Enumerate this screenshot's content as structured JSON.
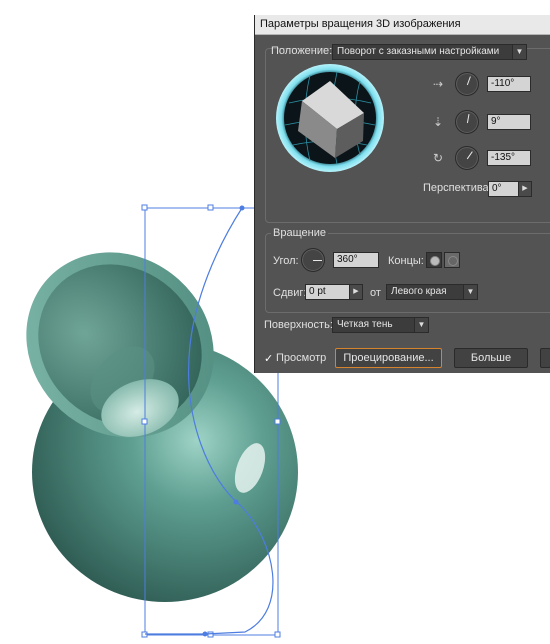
{
  "dialog": {
    "title": "Параметры вращения 3D изображения",
    "position": {
      "label": "Положение:",
      "preset_value": "Поворот с заказными настройками",
      "x_angle": "-110°",
      "y_angle": "9°",
      "z_angle": "-135°",
      "perspective_label": "Перспектива:",
      "perspective_value": "0°"
    },
    "revolve": {
      "title": "Вращение",
      "angle_label": "Угол:",
      "angle_value": "360°",
      "caps_label": "Концы:",
      "offset_label": "Сдвиг:",
      "offset_value": "0 pt",
      "from_label": "от",
      "from_value": "Левого края"
    },
    "surface": {
      "label": "Поверхность:",
      "value": "Четкая тень"
    },
    "footer": {
      "preview_check": "✓",
      "preview_label": "Просмотр",
      "map_art_label": "Проецирование...",
      "more_label": "Больше"
    }
  },
  "icons": [
    "x-axis-icon",
    "y-axis-icon",
    "z-axis-icon",
    "cap-on-icon",
    "cap-off-icon",
    "checkbox-icon",
    "dropdown-arrow-icon"
  ],
  "colors": {
    "vase": "#5a9a8c",
    "path": "#4d7de0",
    "dialog_bg": "#535353",
    "accent": "#d6832d",
    "trackball_ring": "#58c7d9"
  }
}
